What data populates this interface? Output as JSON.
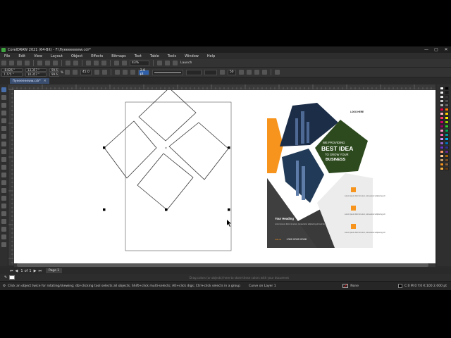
{
  "window": {
    "title": "CorelDRAW 2021 (64-Bit) - F:\\flyeeeeeeww.cdr*",
    "controls": [
      "—",
      "▢",
      "✕"
    ]
  },
  "menu": [
    "File",
    "Edit",
    "View",
    "Layout",
    "Object",
    "Effects",
    "Bitmaps",
    "Text",
    "Table",
    "Tools",
    "Window",
    "Help"
  ],
  "standard_toolbar": {
    "zoom_value": "43%",
    "launch_label": "Launch"
  },
  "property_bar": {
    "x_value": "-8.826 \"",
    "y_value": "7.775 \"",
    "width_value": "13.357 \"",
    "height_value": "10.357 \"",
    "scale_w": "99.6",
    "scale_h": "99.6",
    "scale_unit": "%",
    "rotation_value": "45.0",
    "outline_width": "2.0 pt",
    "miter_value": "50"
  },
  "document_tab": {
    "label": "flyeeeeeeww.cdr*",
    "close": "✕"
  },
  "page_nav": {
    "current": "1",
    "of": "of",
    "total": "1",
    "page_tab": "Page 1"
  },
  "color_hint": "Drag colors (or objects) here to store these colors with your document",
  "status": {
    "hint": "Click an object twice for rotating/skewing; dbl-clicking tool selects all objects; Shift+click multi-selects; Alt+click digs; Ctrl+click selects in a group",
    "layer": "Curve on Layer 1",
    "fill_label": "None",
    "color_info": "C:0 M:0 Y:0 K:100  2.000 pt"
  },
  "flyer": {
    "logo_text": "LOGO HERE",
    "providing": "WE PROVIDING",
    "headline": "BEST IDEA",
    "subline": "TO GROW YOUR",
    "business": "BUSINESS",
    "heading": "Your Heading",
    "body": "Lorem ipsum dolor sit amet, consectetur adipiscing elit sed do",
    "contact_label": "Call us",
    "phone": "+000 0000 0008",
    "bullet_text": "Lorem ipsum dolor sit amet, consectetur adipiscing elit"
  },
  "palette_colors": [
    "#ffffff",
    "#000000",
    "#f2f2f2",
    "#1a1a1a",
    "#e6e6e6",
    "#333333",
    "#cccccc",
    "#4d4d4d",
    "#b3b3b3",
    "#666666",
    "#e6004c",
    "#ff7f00",
    "#ffb3c6",
    "#ffcc00",
    "#ff3366",
    "#fff200",
    "#cc0066",
    "#99cc00",
    "#990066",
    "#33cc33",
    "#ff99cc",
    "#00a651",
    "#ff66b2",
    "#009999",
    "#cc99ff",
    "#00aeef",
    "#9966cc",
    "#0072bc",
    "#6633cc",
    "#2e3192",
    "#ff9966",
    "#662d91",
    "#ffcc99",
    "#a3620a",
    "#c69c6d",
    "#754c24",
    "#f7941d",
    "#8c6239",
    "#fbb040",
    "#603913"
  ]
}
